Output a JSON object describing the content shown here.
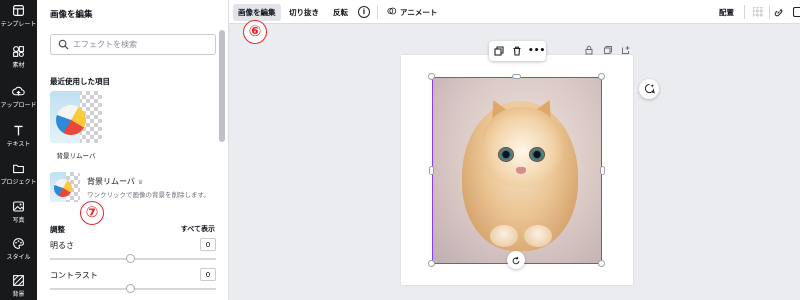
{
  "rail": {
    "items": [
      {
        "label": "テンプレート",
        "icon": "template-icon"
      },
      {
        "label": "素材",
        "icon": "elements-icon"
      },
      {
        "label": "アップロード",
        "icon": "upload-icon"
      },
      {
        "label": "テキスト",
        "icon": "text-icon"
      },
      {
        "label": "プロジェクト",
        "icon": "folder-icon"
      },
      {
        "label": "写真",
        "icon": "photo-icon"
      },
      {
        "label": "スタイル",
        "icon": "palette-icon"
      },
      {
        "label": "背景",
        "icon": "background-icon"
      }
    ]
  },
  "panel": {
    "title": "画像を編集",
    "search_placeholder": "エフェクトを検索",
    "recent_title": "最近使用した項目",
    "recent_item_label": "背景リムーバ",
    "effect": {
      "name": "背景リムーバ",
      "badge": "♛",
      "description": "ワンクリックで画像の背景を削除します。"
    },
    "adjust_title": "調整",
    "show_all": "すべて表示",
    "adjustments": [
      {
        "label": "明るさ",
        "value": "0"
      },
      {
        "label": "コントラスト",
        "value": "0"
      }
    ]
  },
  "markers": {
    "six": "⑥",
    "seven": "⑦"
  },
  "toolbar": {
    "edit_image": "画像を編集",
    "crop": "切り抜き",
    "flip": "反転",
    "info_icon": "i",
    "animate": "アニメート",
    "position": "配置"
  },
  "colors": {
    "accent": "#8b3dff",
    "marker": "#e8262b",
    "rail": "#18191b"
  }
}
